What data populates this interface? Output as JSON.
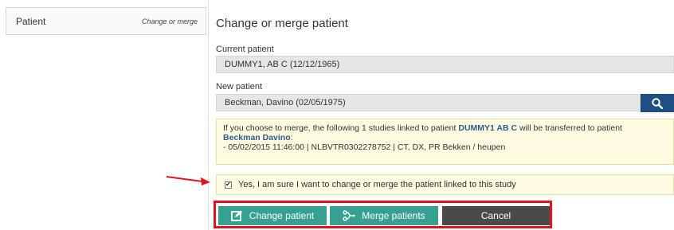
{
  "sidebar": {
    "item_label": "Patient",
    "item_link": "Change or merge"
  },
  "main": {
    "title": "Change or merge patient",
    "current_patient": {
      "label": "Current patient",
      "value": "DUMMY1, AB C (12/12/1965)"
    },
    "new_patient": {
      "label": "New patient",
      "value": "Beckman, Davino (02/05/1975)"
    },
    "info": {
      "text_before_count": "If you choose to merge, the following ",
      "count": "1",
      "text_after_count": " studies linked to patient ",
      "from_patient": "DUMMY1 AB C",
      "text_middle": " will be transferred to patient",
      "to_patient": "Beckman Davino",
      "colon": ":",
      "study_line": "- 05/02/2015 11:46:00 | NLBVTR0302278752 | CT, DX, PR Bekken / heupen"
    },
    "confirm": {
      "checked": true,
      "label": "Yes, I am sure I want to change or merge the patient linked to this study"
    },
    "buttons": {
      "change": "Change patient",
      "merge": "Merge patients",
      "cancel": "Cancel"
    }
  },
  "colors": {
    "accent_teal": "#36a192",
    "search_blue": "#1f4f82",
    "cancel_dark": "#4a4a4a",
    "highlight_red": "#e0141c",
    "info_bg": "#fffbe0"
  },
  "icons": {
    "search": "search-icon",
    "change": "edit-icon",
    "merge": "merge-icon",
    "arrow": "red-arrow-icon"
  }
}
